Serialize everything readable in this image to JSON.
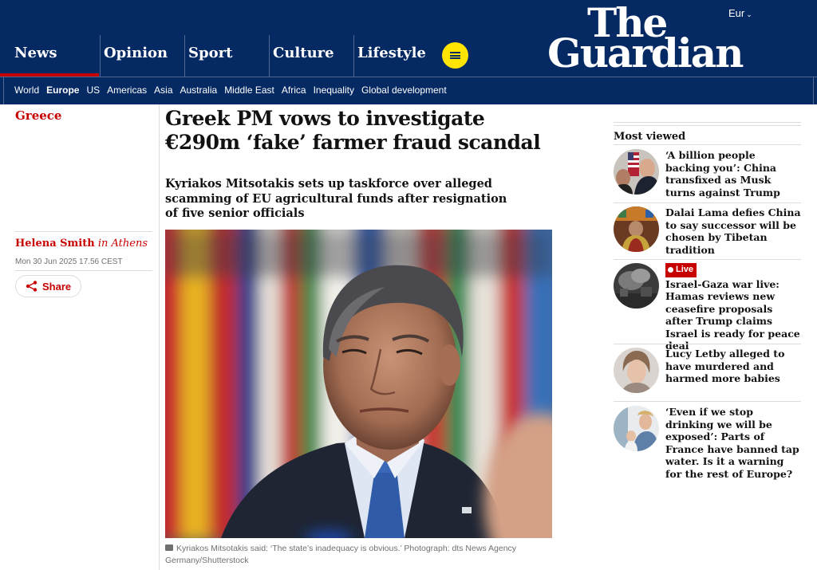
{
  "header": {
    "edition": "Eur",
    "logo": {
      "line1": "The",
      "line2": "Guardian"
    },
    "pillars": [
      "News",
      "Opinion",
      "Sport",
      "Culture",
      "Lifestyle"
    ],
    "subnav": [
      "World",
      "Europe",
      "US",
      "Americas",
      "Asia",
      "Australia",
      "Middle East",
      "Africa",
      "Inequality",
      "Global development"
    ]
  },
  "article": {
    "section": "Greece",
    "headline": "Greek PM vows to investigate €290m ‘fake’ farmer fraud scandal",
    "standfirst": "Kyriakos Mitsotakis sets up taskforce over alleged scamming of EU agricultural funds after resignation of five senior officials",
    "byline_name": "Helena Smith",
    "byline_place": "in Athens",
    "date": "Mon 30 Jun 2025 17.56 CEST",
    "share_label": "Share",
    "caption": "Kyriakos Mitsotakis said: ‘The state’s inadequacy is obvious.’ Photograph: dts News Agency Germany/Shutterstock"
  },
  "most_viewed": {
    "title": "Most viewed",
    "items": [
      {
        "text": "‘A billion people backing you’: China transfixed as Musk turns against Trump",
        "live": false
      },
      {
        "text": "Dalai Lama defies China to say successor will be chosen by Tibetan tradition",
        "live": false
      },
      {
        "text": "Israel-Gaza war live: Hamas reviews new ceasefire proposals after Trump claims Israel is ready for peace deal",
        "live": true,
        "live_label": "Live"
      },
      {
        "text": "Lucy Letby alleged to have murdered and harmed more babies",
        "live": false
      },
      {
        "text": "‘Even if we stop drinking we will be exposed’: Parts of France have banned tap water. Is it a warning for the rest of Europe?",
        "live": false
      }
    ]
  },
  "colors": {
    "brand_blue": "#052962",
    "news_red": "#c70000",
    "menu_yellow": "#ffe500"
  }
}
